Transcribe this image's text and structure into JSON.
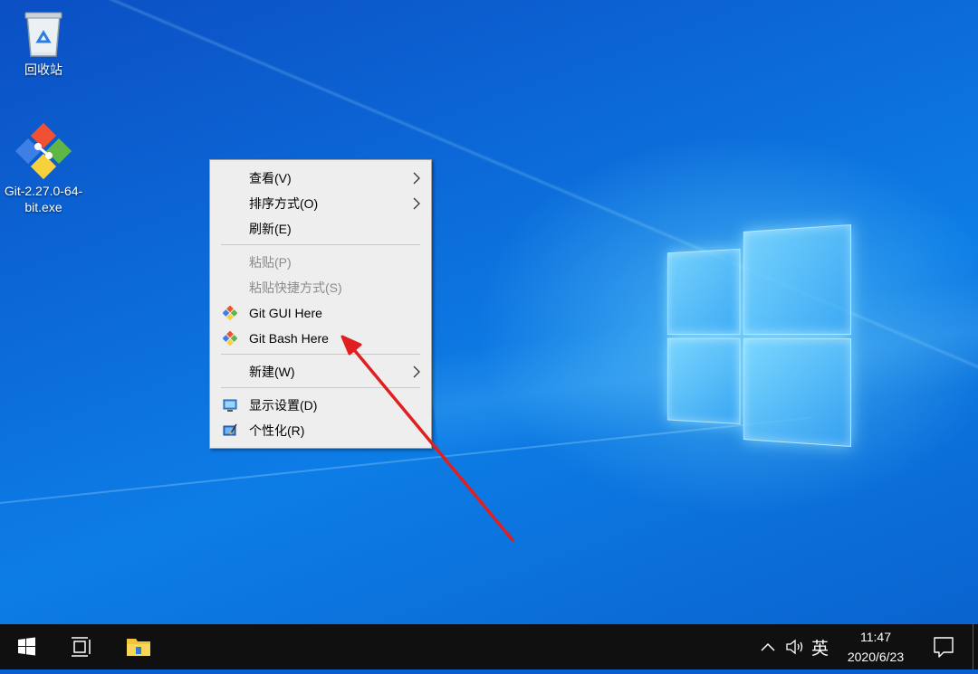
{
  "desktop": {
    "icons": [
      {
        "label": "回收站",
        "icon": "recycle-bin-icon"
      },
      {
        "label": "Git-2.27.0-64-bit.exe",
        "icon": "git-installer-icon"
      }
    ]
  },
  "context_menu": {
    "items": [
      {
        "label": "查看(V)",
        "submenu": true
      },
      {
        "label": "排序方式(O)",
        "submenu": true
      },
      {
        "label": "刷新(E)"
      },
      {
        "label": "粘贴(P)",
        "disabled": true
      },
      {
        "label": "粘贴快捷方式(S)",
        "disabled": true
      },
      {
        "label": "Git GUI Here",
        "icon": "git-icon"
      },
      {
        "label": "Git Bash Here",
        "icon": "git-icon"
      },
      {
        "label": "新建(W)",
        "submenu": true
      },
      {
        "label": "显示设置(D)",
        "icon": "display-settings-icon"
      },
      {
        "label": "个性化(R)",
        "icon": "personalize-icon"
      }
    ]
  },
  "annotation": {
    "color": "#e02020",
    "points_to": "Git Bash Here"
  },
  "taskbar": {
    "ime": "英",
    "time": "11:47",
    "date": "2020/6/23"
  },
  "colors": {
    "desktop_blue": "#0c6ad8",
    "taskbar": "#101010",
    "menu_bg": "#eeeeee",
    "git_orange": "#f05133"
  }
}
